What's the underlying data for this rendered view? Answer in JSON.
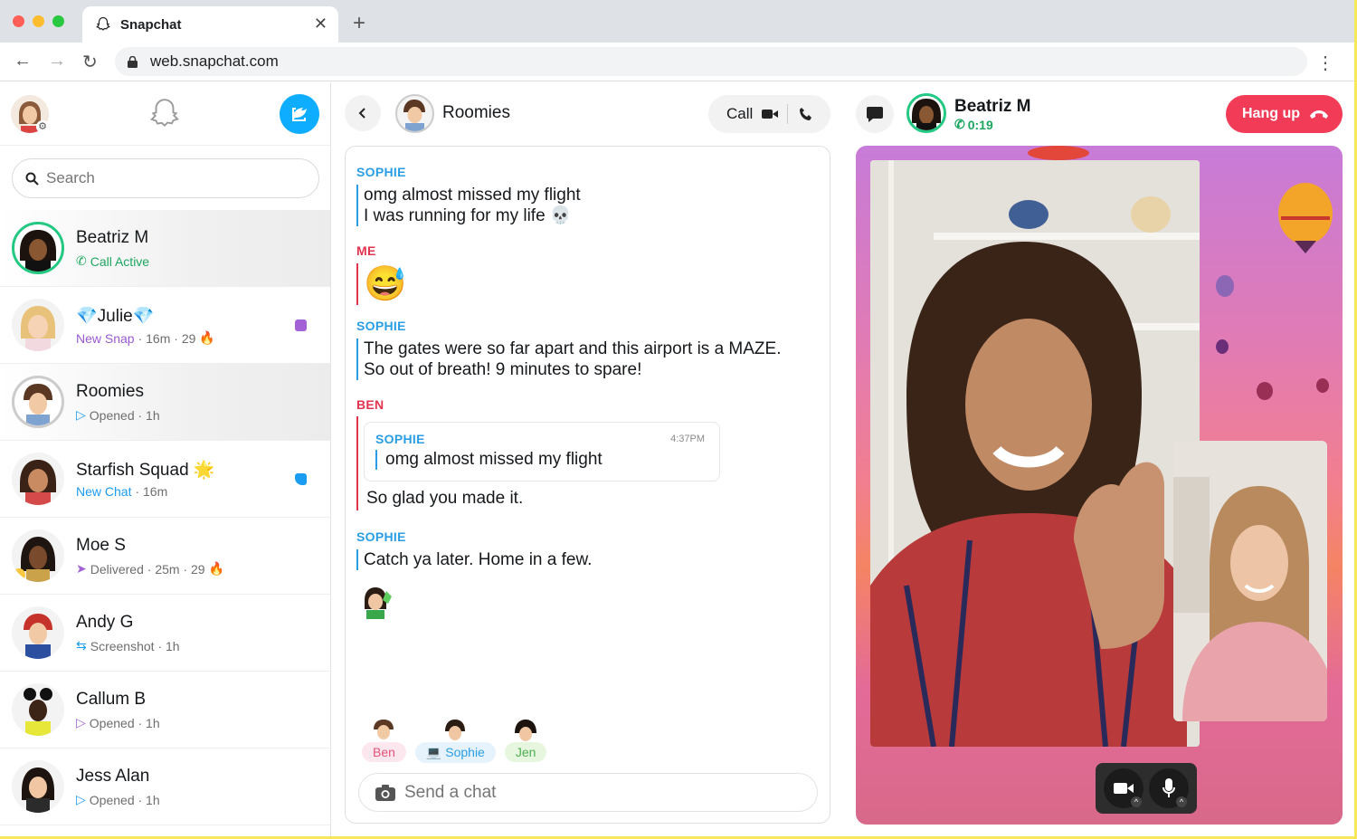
{
  "browser": {
    "tab_title": "Snapchat",
    "new_tab": "+",
    "url": "web.snapchat.com"
  },
  "sidebar": {
    "search_placeholder": "Search",
    "chats": [
      {
        "name": "Beatriz M",
        "status": "Call Active",
        "status_color": "#1da65f",
        "active": true
      },
      {
        "name": "💎Julie💎",
        "status_label": "New Snap",
        "status_rest": " · 16m · 29",
        "label_color": "#9b59d0",
        "badge_color": "#a363d6",
        "fire": "🔥"
      },
      {
        "name": "Roomies",
        "status": "Opened · 1h"
      },
      {
        "name": "Starfish Squad",
        "status_label": "New Chat",
        "status_rest": " · 16m",
        "label_color": "#1a9cf0",
        "badge_color": "#1a9cf0",
        "emoji": "🌟"
      },
      {
        "name": "Moe S",
        "status": "Delivered · 25m · 29",
        "fire": "🔥"
      },
      {
        "name": "Andy G",
        "status": "Screenshot · 1h"
      },
      {
        "name": "Callum B",
        "status": "Opened · 1h"
      },
      {
        "name": "Jess Alan",
        "status": "Opened · 1h"
      }
    ]
  },
  "chat": {
    "title": "Roomies",
    "call_label": "Call",
    "messages": [
      {
        "sender": "SOPHIE",
        "lines": [
          "omg almost missed my flight",
          "I was running for my life 💀"
        ]
      },
      {
        "sender": "ME",
        "emoji": "😅"
      },
      {
        "sender": "SOPHIE",
        "lines": [
          "The gates were so far apart and this airport is a MAZE.",
          "So out of breath! 9 minutes to spare!"
        ]
      },
      {
        "sender": "BEN",
        "quote_sender": "SOPHIE",
        "quote_time": "4:37PM",
        "quote_text": "omg almost missed my flight",
        "text": "So glad you made it."
      },
      {
        "sender": "SOPHIE",
        "lines": [
          "Catch ya later. Home in a few."
        ]
      }
    ],
    "present": [
      {
        "name": "Ben",
        "bg": "#fde7ee",
        "fg": "#e3547a"
      },
      {
        "name": "Sophie",
        "bg": "#e6f3fd",
        "fg": "#2a9ee5"
      },
      {
        "name": "Jen",
        "bg": "#e7f7df",
        "fg": "#4caf50"
      }
    ],
    "composer_placeholder": "Send a chat"
  },
  "call": {
    "caller": "Beatriz M",
    "duration": "0:19",
    "hangup_label": "Hang up"
  },
  "colors": {
    "accent_blue": "#0eadff",
    "hangup_red": "#f23c57",
    "call_green": "#23c882"
  }
}
